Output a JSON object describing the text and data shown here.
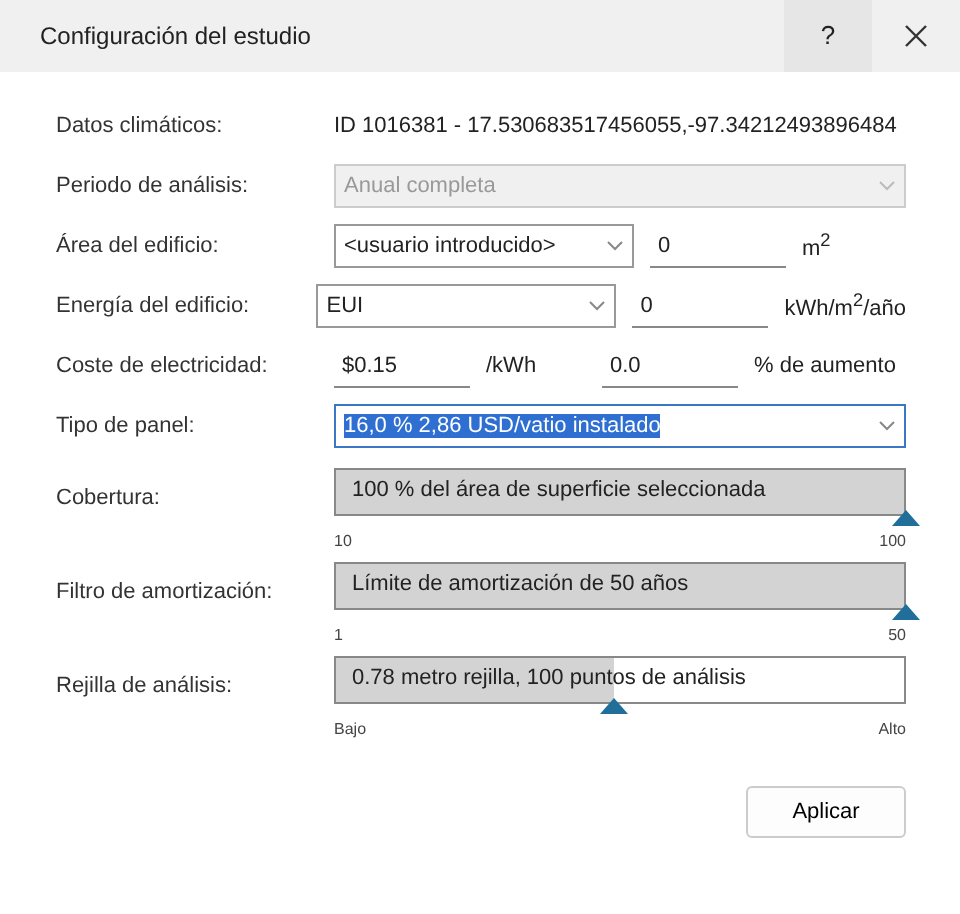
{
  "window": {
    "title": "Configuración del estudio",
    "help": "?"
  },
  "rows": [
    {
      "kind": "text",
      "label": "Datos climáticos:",
      "value": "ID 1016381 - 17.530683517456055,-97.34212493896484"
    },
    {
      "kind": "select",
      "label": "Periodo de análisis:",
      "value": "Anual completa",
      "disabled": true,
      "highlighted": false
    },
    {
      "kind": "select_input",
      "label": "Área del edificio:",
      "value": "<usuario introducido>",
      "input": "0",
      "unit": "m$^{2}$"
    },
    {
      "kind": "select_input",
      "label": "Energía del edificio:",
      "value": "EUI",
      "input": "0",
      "unit": "kWh/m$^{2}$/año"
    },
    {
      "kind": "input_pair",
      "label": "Coste de electricidad:",
      "input": "$0.15",
      "unit": "/kWh",
      "input_2": "0.0",
      "unit_2": "% de aumento"
    },
    {
      "kind": "select",
      "label": "Tipo de panel:",
      "value": "16,0 % 2,86 USD/vatio instalado",
      "disabled": false,
      "highlighted": true
    },
    {
      "kind": "slider",
      "label": "Cobertura:",
      "text": "100 % del área de superficie seleccionada",
      "level": 1,
      "min": "10",
      "max": "100"
    },
    {
      "kind": "slider",
      "label": "Filtro de amortización:",
      "text": "Límite de amortización de 50 años",
      "level": 1,
      "min": "1",
      "max": "50"
    },
    {
      "kind": "slider",
      "label": "Rejilla de análisis:",
      "text": "0.78 metro rejilla, 100 puntos de análisis",
      "level": 0.49,
      "min": "Bajo",
      "max": "Alto"
    }
  ],
  "buttons": [
    {
      "label": "Aplicar"
    }
  ]
}
